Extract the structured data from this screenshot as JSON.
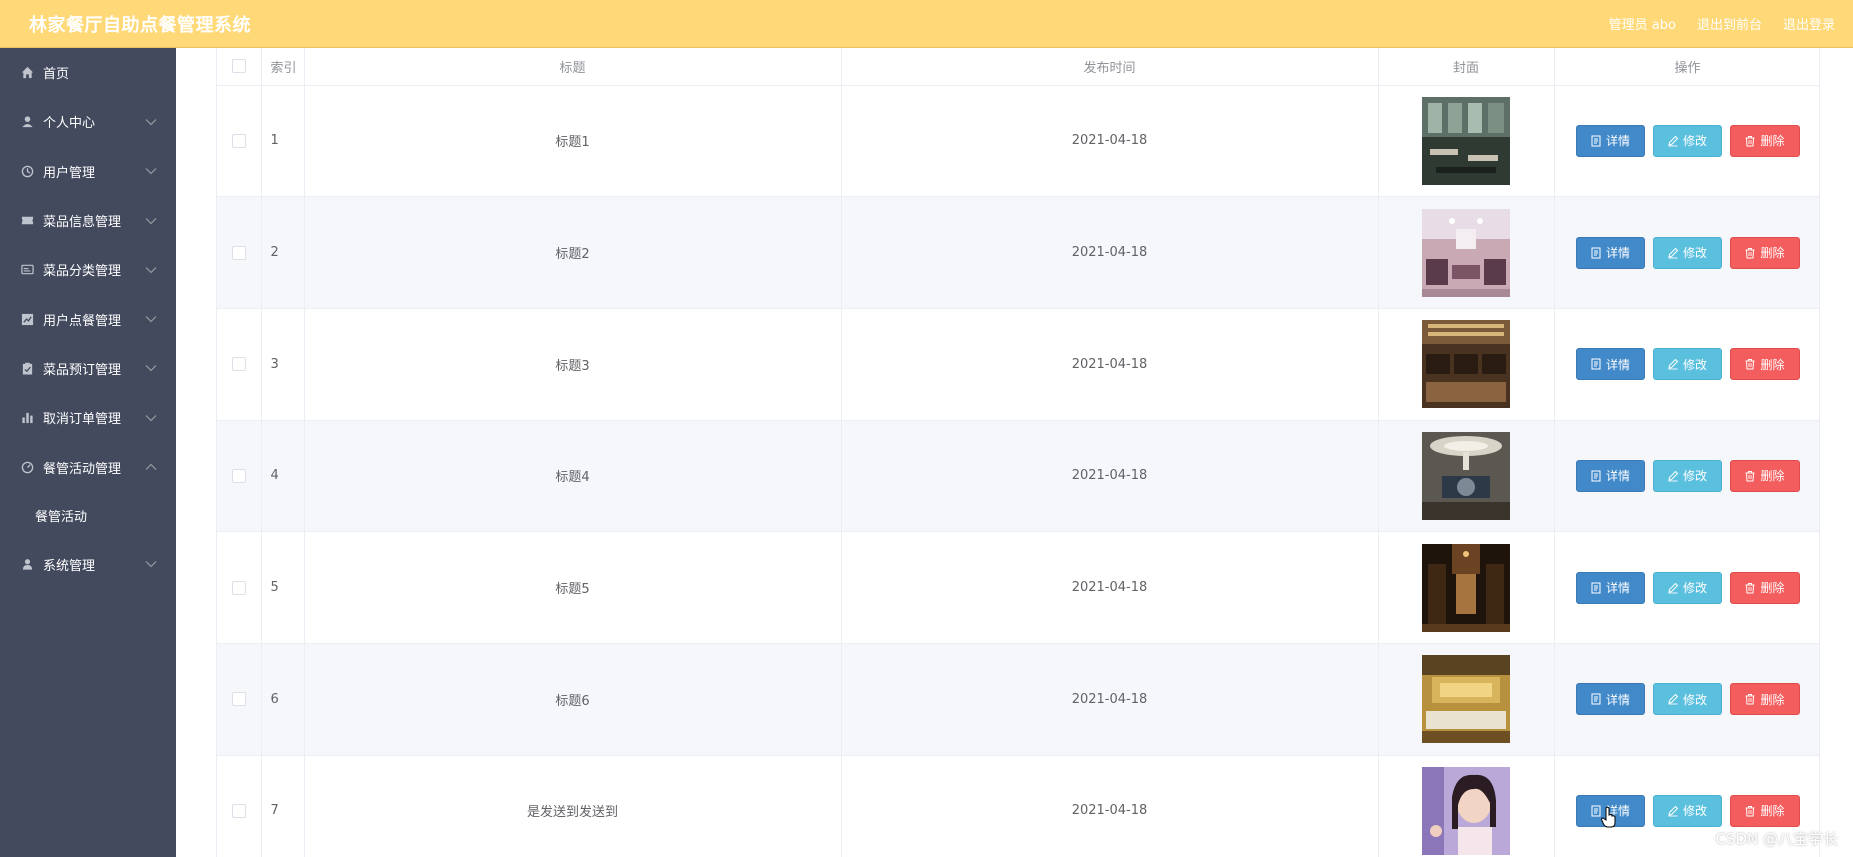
{
  "header": {
    "title": "林家餐厅自助点餐管理系统",
    "user": "管理员 abo",
    "to_front": "退出到前台",
    "logout": "退出登录"
  },
  "sidebar": {
    "items": [
      {
        "label": "首页",
        "icon": "home-icon"
      },
      {
        "label": "个人中心",
        "icon": "user-icon"
      },
      {
        "label": "用户管理",
        "icon": "clock-icon"
      },
      {
        "label": "菜品信息管理",
        "icon": "ticket-icon"
      },
      {
        "label": "菜品分类管理",
        "icon": "card-icon"
      },
      {
        "label": "用户点餐管理",
        "icon": "chart-icon"
      },
      {
        "label": "菜品预订管理",
        "icon": "clipboard-icon"
      },
      {
        "label": "取消订单管理",
        "icon": "bars-icon"
      },
      {
        "label": "餐管活动管理",
        "icon": "gauge-icon"
      },
      {
        "label": "系统管理",
        "icon": "person-icon"
      }
    ],
    "active_sub": "餐管活动"
  },
  "table": {
    "columns": [
      "索引",
      "标题",
      "发布时间",
      "封面",
      "操作"
    ],
    "buttons": {
      "detail": "详情",
      "edit": "修改",
      "delete": "删除"
    },
    "rows": [
      {
        "index": "1",
        "title": "标题1",
        "date": "2021-04-18"
      },
      {
        "index": "2",
        "title": "标题2",
        "date": "2021-04-18"
      },
      {
        "index": "3",
        "title": "标题3",
        "date": "2021-04-18"
      },
      {
        "index": "4",
        "title": "标题4",
        "date": "2021-04-18"
      },
      {
        "index": "5",
        "title": "标题5",
        "date": "2021-04-18"
      },
      {
        "index": "6",
        "title": "标题6",
        "date": "2021-04-18"
      },
      {
        "index": "7",
        "title": "是发送到发送到",
        "date": "2021-04-18"
      }
    ]
  },
  "watermark": "CSDN @八宝学长",
  "colors": {
    "header_bg": "#ffd978",
    "sidebar_bg": "#434a5e",
    "detail_btn": "#4189c9",
    "edit_btn": "#5bc0de",
    "delete_btn": "#f45d5d"
  }
}
